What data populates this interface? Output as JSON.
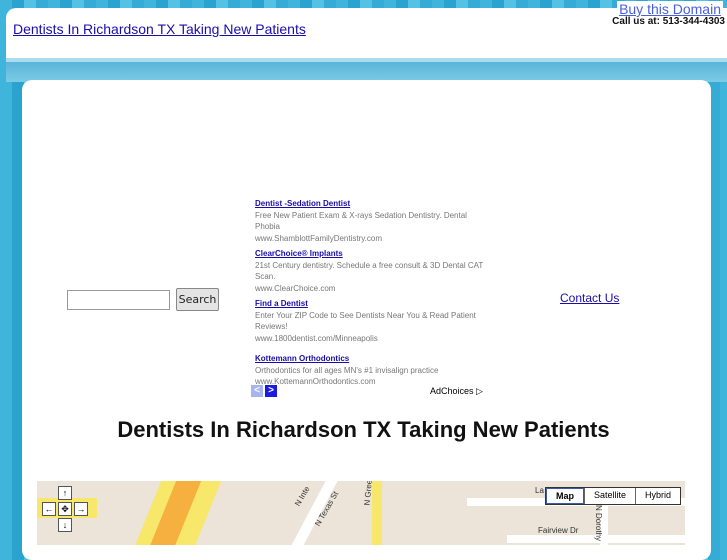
{
  "header": {
    "title": "Dentists In Richardson TX Taking New Patients",
    "buy_domain": "Buy this Domain",
    "call": "Call us at: 513-344-4303"
  },
  "search": {
    "placeholder": "",
    "button": "Search"
  },
  "ads": [
    {
      "title": "Dentist -Sedation Dentist",
      "text": "Free New Patient Exam & X-rays Sedation Dentistry. Dental Phobia",
      "url": "www.ShamblottFamilyDentistry.com"
    },
    {
      "title": "ClearChoice® Implants",
      "text": "21st Century dentistry. Schedule a free consult & 3D Dental CAT Scan.",
      "url": "www.ClearChoice.com"
    },
    {
      "title": "Find a Dentist",
      "text": "Enter Your ZIP Code to See Dentists Near You & Read Patient Reviews!",
      "url": "www.1800dentist.com/Minneapolis"
    },
    {
      "title": "Kottemann Orthodontics",
      "text": "Orthodontics for all ages MN's #1 invisalign practice",
      "url": "www.KottemannOrthodontics.com"
    }
  ],
  "adchoices": "AdChoices ▷",
  "contact": "Contact Us",
  "heading": "Dentists In Richardson TX Taking New Patients",
  "map": {
    "types": [
      "Map",
      "Satellite",
      "Hybrid"
    ],
    "labels": [
      "N Greenville Ave",
      "N Texas St",
      "Fairview Dr",
      "N Dorothy",
      "N Inte",
      "La"
    ],
    "pan": {
      "up": "↑",
      "left": "←",
      "center": "✥",
      "right": "→",
      "down": "↓"
    }
  }
}
